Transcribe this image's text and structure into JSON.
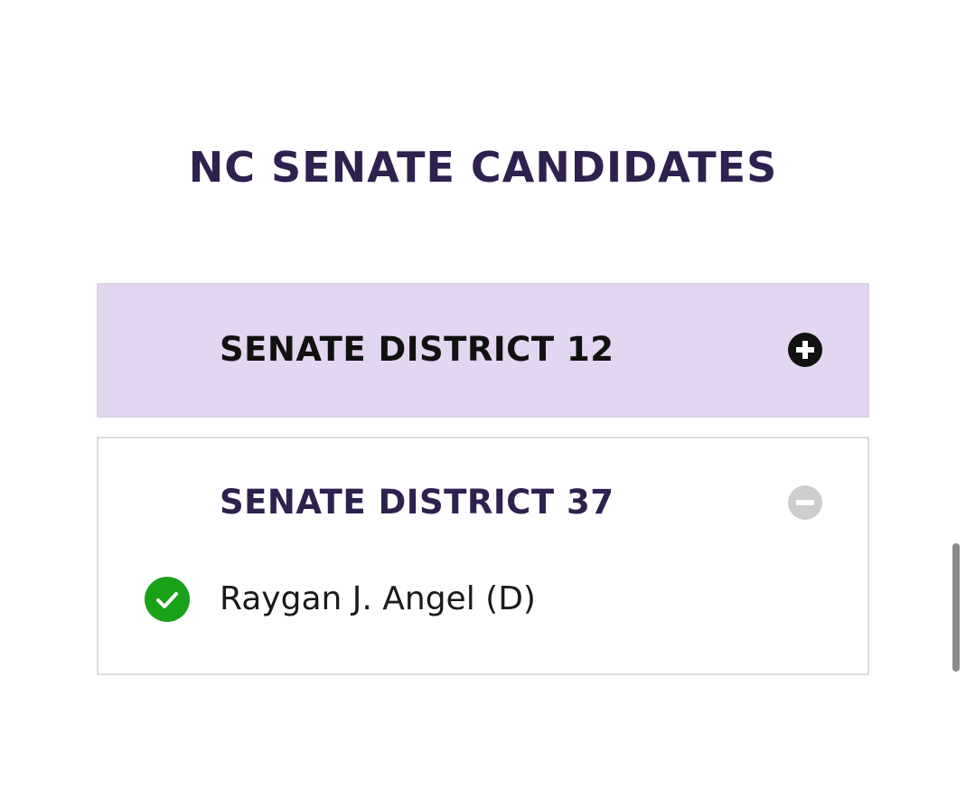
{
  "page": {
    "title": "NC SENATE CANDIDATES"
  },
  "accordion": {
    "items": [
      {
        "title": "SENATE DISTRICT 12",
        "state": "collapsed",
        "toggle_icon": "plus-circle-icon"
      },
      {
        "title": "SENATE DISTRICT 37",
        "state": "expanded",
        "toggle_icon": "minus-circle-icon",
        "candidates": [
          {
            "name": "Raygan J. Angel (D)",
            "status_icon": "check-circle-icon"
          }
        ]
      }
    ]
  },
  "colors": {
    "title_purple": "#2e2150",
    "collapsed_bg": "#e3d6f0",
    "collapsed_text": "#111111",
    "expanded_text": "#2e2150",
    "minus_icon": "#cdcdcd",
    "check_green": "#1aa11a",
    "candidate_text": "#1a1a1a",
    "scrollbar": "#8a8a8a"
  }
}
